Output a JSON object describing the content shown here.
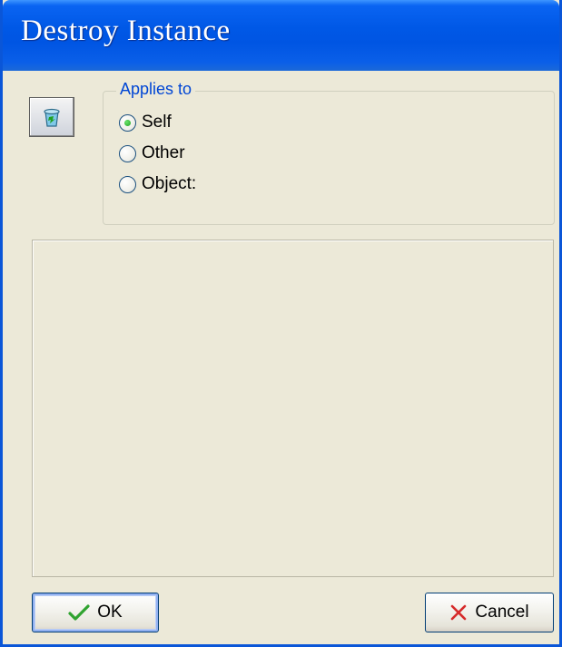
{
  "window": {
    "title": "Destroy Instance"
  },
  "action_icon": {
    "name": "trash-can-icon"
  },
  "applies_to": {
    "legend": "Applies to",
    "options": [
      {
        "label": "Self",
        "checked": true
      },
      {
        "label": "Other",
        "checked": false
      },
      {
        "label": "Object:",
        "checked": false
      }
    ]
  },
  "buttons": {
    "ok_label": "OK",
    "cancel_label": "Cancel"
  },
  "colors": {
    "titlebar": "#0058e6",
    "legend": "#0046d5",
    "ok_check": "#2fa32f",
    "cancel_x": "#d62b2b"
  }
}
